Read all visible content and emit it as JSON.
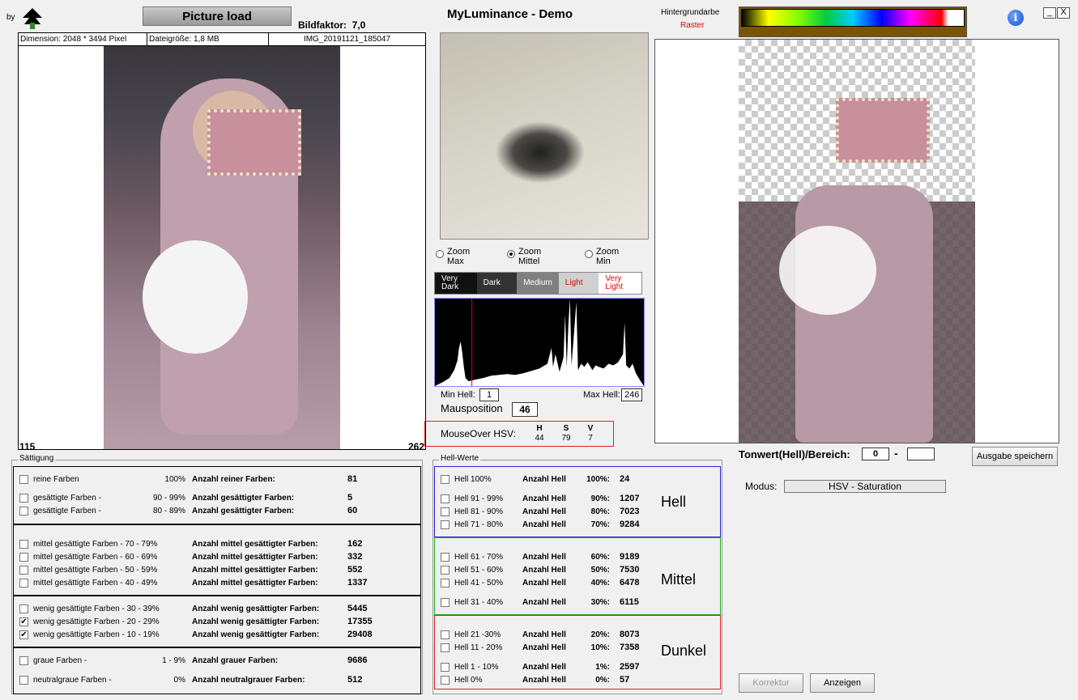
{
  "header": {
    "by": "by",
    "load_button": "Picture load",
    "bildfaktor_label": "Bildfaktor:",
    "bildfaktor_value": "7,0",
    "title": "MyLuminance - Demo",
    "hintergrund_label": "Hintergrundarbe",
    "hintergrund_value": "Raster",
    "minimize": "_",
    "close": "X",
    "info": "i"
  },
  "image": {
    "dimension": "Dimension: 2048 * 3494 Pixel",
    "size": "Dateigröße: 1,8 MB",
    "name": "IMG_20191121_185047",
    "count_left": "115",
    "count_right": "262"
  },
  "zoom": {
    "options": [
      {
        "line1": "Zoom",
        "line2": "Max",
        "selected": false
      },
      {
        "line1": "Zoom",
        "line2": "Mittel",
        "selected": true
      },
      {
        "line1": "Zoom",
        "line2": "Min",
        "selected": false
      }
    ]
  },
  "lumbar": [
    {
      "line1": "Very",
      "line2": "Dark",
      "bg": "#111111",
      "fg": "#ffffff"
    },
    {
      "line1": "Dark",
      "line2": "",
      "bg": "#333333",
      "fg": "#ffffff"
    },
    {
      "line1": "Medium",
      "line2": "",
      "bg": "#808080",
      "fg": "#ffffff"
    },
    {
      "line1": "Light",
      "line2": "",
      "bg": "#d0d0d0",
      "fg": "#dd0000"
    },
    {
      "line1": "Very",
      "line2": "Light",
      "bg": "#ffffff",
      "fg": "#dd0000"
    }
  ],
  "histogram": {
    "min_label": "Min Hell:",
    "min_value": "1",
    "max_label": "Max Hell:",
    "max_value": "246",
    "mauspos_label": "Mausposition",
    "mauspos_value": "46"
  },
  "mouseover": {
    "label": "MouseOver HSV:",
    "h_label": "H",
    "h": "44",
    "s_label": "S",
    "s": "79",
    "v_label": "V",
    "v": "7"
  },
  "right": {
    "tonwert_label": "Tonwert(Hell)/Bereich:",
    "tonwert_from": "0",
    "tonwert_sep": "-",
    "tonwert_to": "",
    "save_button": "Ausgabe speichern",
    "modus_label": "Modus:",
    "modus_value": "HSV - Saturation",
    "korrektur_button": "Korrektur",
    "anzeigen_button": "Anzeigen"
  },
  "saettigung": {
    "legend": "Sättigung",
    "rows": [
      {
        "label": "reine Farben",
        "range": "100%",
        "name": "Anzahl reiner Farben:",
        "value": "81",
        "checked": false
      },
      {
        "label": "gesättigte Farben  -",
        "range": "90 - 99%",
        "name": "Anzahl gesättigter Farben:",
        "value": "5",
        "checked": false
      },
      {
        "label": "gesättigte Farben  -",
        "range": "80 - 89%",
        "name": "Anzahl gesättigter Farben:",
        "value": "60",
        "checked": false
      },
      {
        "label": "mittel gesättigte Farben  - 70 - 79%",
        "range": "",
        "name": "Anzahl mittel gesättigter Farben:",
        "value": "162",
        "checked": false
      },
      {
        "label": "mittel gesättigte Farben  - 60 - 69%",
        "range": "",
        "name": "Anzahl mittel gesättigter Farben:",
        "value": "332",
        "checked": false
      },
      {
        "label": "mittel gesättigte Farben  - 50 - 59%",
        "range": "",
        "name": "Anzahl mittel gesättigter Farben:",
        "value": "552",
        "checked": false
      },
      {
        "label": "mittel gesättigte Farben  - 40 - 49%",
        "range": "",
        "name": "Anzahl mittel gesättigter Farben:",
        "value": "1337",
        "checked": false
      },
      {
        "label": "wenig gesättigte Farben - 30 - 39%",
        "range": "",
        "name": "Anzahl wenig gesättigter Farben:",
        "value": "5445",
        "checked": false
      },
      {
        "label": "wenig gesättigte Farben - 20 - 29%",
        "range": "",
        "name": "Anzahl wenig gesättigter Farben:",
        "value": "17355",
        "checked": true
      },
      {
        "label": "wenig gesättigte Farben - 10 - 19%",
        "range": "",
        "name": "Anzahl wenig gesättigter Farben:",
        "value": "29408",
        "checked": true
      },
      {
        "label": "graue Farben -",
        "range": "1 -  9%",
        "name": "Anzahl grauer Farben:",
        "value": "9686",
        "checked": false
      },
      {
        "label": "neutralgraue Farben -",
        "range": "0%",
        "name": "Anzahl neutralgrauer Farben:",
        "value": "512",
        "checked": false
      }
    ]
  },
  "hellwerte": {
    "legend": "Hell-Werte",
    "group_labels": [
      "Hell",
      "Mittel",
      "Dunkel"
    ],
    "rows": [
      {
        "label": "Hell     100%",
        "name": "Anzahl Hell",
        "pct": "100%:",
        "value": "24"
      },
      {
        "label": "Hell 91 - 99%",
        "name": "Anzahl Hell",
        "pct": "90%:",
        "value": "1207"
      },
      {
        "label": "Hell 81 - 90%",
        "name": "Anzahl Hell",
        "pct": "80%:",
        "value": "7023"
      },
      {
        "label": "Hell 71 - 80%",
        "name": "Anzahl Hell",
        "pct": "70%:",
        "value": "9284"
      },
      {
        "label": "Hell 61 - 70%",
        "name": "Anzahl Hell",
        "pct": "60%:",
        "value": "9189"
      },
      {
        "label": "Hell 51 - 60%",
        "name": "Anzahl Hell",
        "pct": "50%:",
        "value": "7530"
      },
      {
        "label": "Hell 41 - 50%",
        "name": "Anzahl Hell",
        "pct": "40%:",
        "value": "6478"
      },
      {
        "label": "Hell 31 - 40%",
        "name": "Anzahl Hell",
        "pct": "30%:",
        "value": "6115"
      },
      {
        "label": "Hell 21 -30%",
        "name": "Anzahl Hell",
        "pct": "20%:",
        "value": "8073"
      },
      {
        "label": "Hell 11 - 20%",
        "name": "Anzahl Hell",
        "pct": "10%:",
        "value": "7358"
      },
      {
        "label": "Hell  1 - 10%",
        "name": "Anzahl Hell",
        "pct": "1%:",
        "value": "2597"
      },
      {
        "label": "Hell      0%",
        "name": "Anzahl Hell",
        "pct": "0%:",
        "value": "57"
      }
    ]
  }
}
